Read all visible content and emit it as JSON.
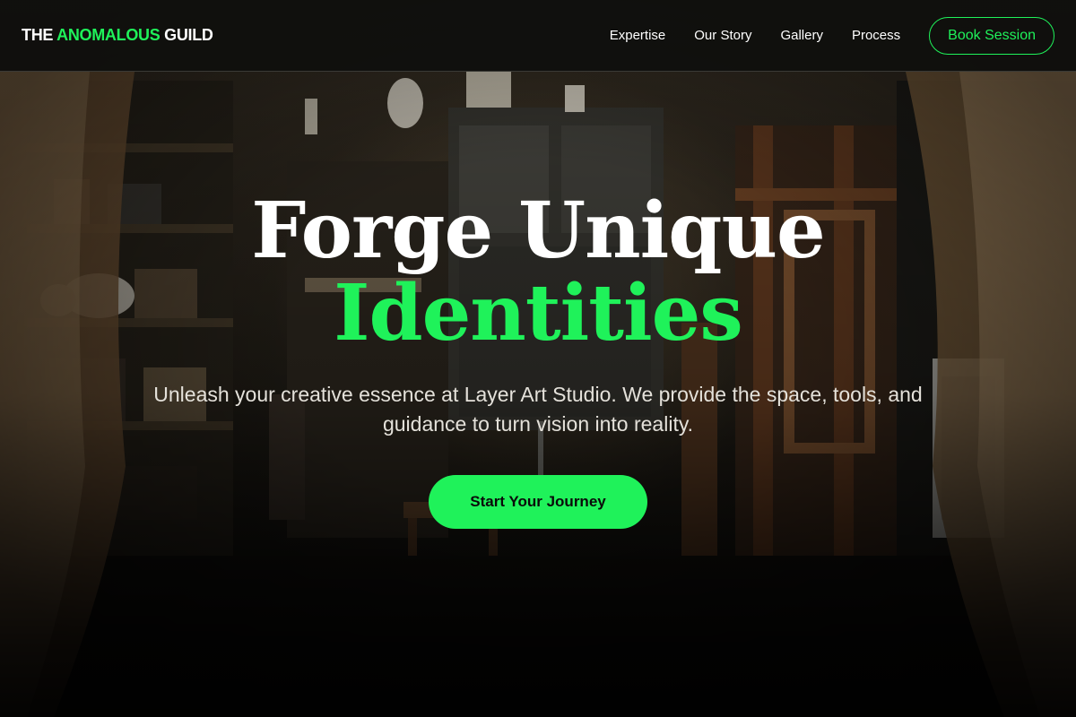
{
  "brand": {
    "prefix": "THE ",
    "accent": "ANOMALOUS",
    "suffix": " GUILD"
  },
  "nav": {
    "links": [
      "Expertise",
      "Our Story",
      "Gallery",
      "Process"
    ],
    "cta_label": "Book Session"
  },
  "hero": {
    "title_line1": "Forge Unique",
    "title_line2": "Identities",
    "subtitle": "Unleash your creative essence at Layer Art Studio. We provide the space, tools, and guidance to turn vision into reality.",
    "cta_label": "Start Your Journey"
  },
  "colors": {
    "accent": "#1ff25a",
    "nav_background": "#10100e",
    "text": "#ffffff"
  }
}
